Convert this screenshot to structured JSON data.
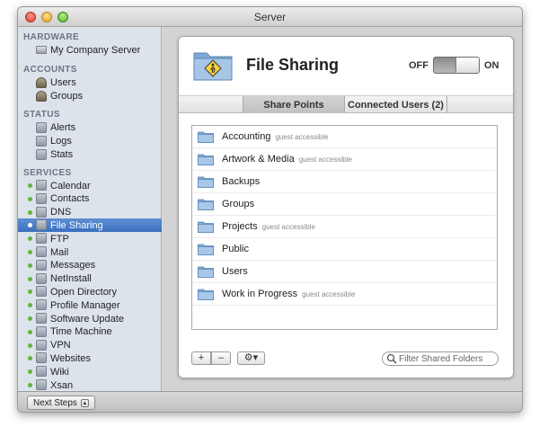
{
  "window": {
    "title": "Server"
  },
  "sidebar": {
    "sections": [
      {
        "header": "HARDWARE",
        "items": [
          {
            "label": "My Company Server",
            "icon": "server-icon"
          }
        ]
      },
      {
        "header": "ACCOUNTS",
        "items": [
          {
            "label": "Users",
            "icon": "user-icon"
          },
          {
            "label": "Groups",
            "icon": "group-icon"
          }
        ]
      },
      {
        "header": "STATUS",
        "items": [
          {
            "label": "Alerts",
            "icon": "alert-icon"
          },
          {
            "label": "Logs",
            "icon": "logs-icon"
          },
          {
            "label": "Stats",
            "icon": "stats-icon"
          }
        ]
      },
      {
        "header": "SERVICES",
        "items": [
          {
            "label": "Calendar",
            "icon": "calendar-icon",
            "status": "on"
          },
          {
            "label": "Contacts",
            "icon": "contacts-icon",
            "status": "on"
          },
          {
            "label": "DNS",
            "icon": "dns-icon",
            "status": "on"
          },
          {
            "label": "File Sharing",
            "icon": "file-sharing-icon",
            "status": "on",
            "selected": true
          },
          {
            "label": "FTP",
            "icon": "ftp-icon",
            "status": "on"
          },
          {
            "label": "Mail",
            "icon": "mail-icon",
            "status": "on"
          },
          {
            "label": "Messages",
            "icon": "messages-icon",
            "status": "on"
          },
          {
            "label": "NetInstall",
            "icon": "netinstall-icon",
            "status": "on"
          },
          {
            "label": "Open Directory",
            "icon": "open-directory-icon",
            "status": "on"
          },
          {
            "label": "Profile Manager",
            "icon": "profile-manager-icon",
            "status": "on"
          },
          {
            "label": "Software Update",
            "icon": "software-update-icon",
            "status": "on"
          },
          {
            "label": "Time Machine",
            "icon": "time-machine-icon",
            "status": "on"
          },
          {
            "label": "VPN",
            "icon": "vpn-icon",
            "status": "on"
          },
          {
            "label": "Websites",
            "icon": "websites-icon",
            "status": "on"
          },
          {
            "label": "Wiki",
            "icon": "wiki-icon",
            "status": "on"
          },
          {
            "label": "Xsan",
            "icon": "xsan-icon",
            "status": "on"
          }
        ]
      }
    ]
  },
  "footer": {
    "next_steps_label": "Next Steps"
  },
  "panel": {
    "title": "File Sharing",
    "toggle": {
      "off_label": "OFF",
      "on_label": "ON",
      "state": "on"
    },
    "tabs": [
      {
        "label": "Share Points",
        "active": true
      },
      {
        "label": "Connected Users (2)",
        "active": false
      }
    ],
    "share_points": [
      {
        "name": "Accounting",
        "tag": "guest accessible",
        "icon": "folder-icon"
      },
      {
        "name": "Artwork & Media",
        "tag": "guest accessible",
        "icon": "folder-icon"
      },
      {
        "name": "Backups",
        "tag": "",
        "icon": "folder-icon"
      },
      {
        "name": "Groups",
        "tag": "",
        "icon": "group-folder-icon"
      },
      {
        "name": "Projects",
        "tag": "guest accessible",
        "icon": "folder-icon"
      },
      {
        "name": "Public",
        "tag": "",
        "icon": "folder-icon"
      },
      {
        "name": "Users",
        "tag": "",
        "icon": "users-folder-icon"
      },
      {
        "name": "Work in Progress",
        "tag": "guest accessible",
        "icon": "folder-icon"
      }
    ],
    "buttons": {
      "add_label": "+",
      "remove_label": "–",
      "action_label": "⚙▾"
    },
    "search": {
      "placeholder": "Filter Shared Folders"
    }
  },
  "colors": {
    "selection": "#3b6fc0",
    "status_on": "#5eb63a",
    "folder": "#8fb2d6"
  }
}
